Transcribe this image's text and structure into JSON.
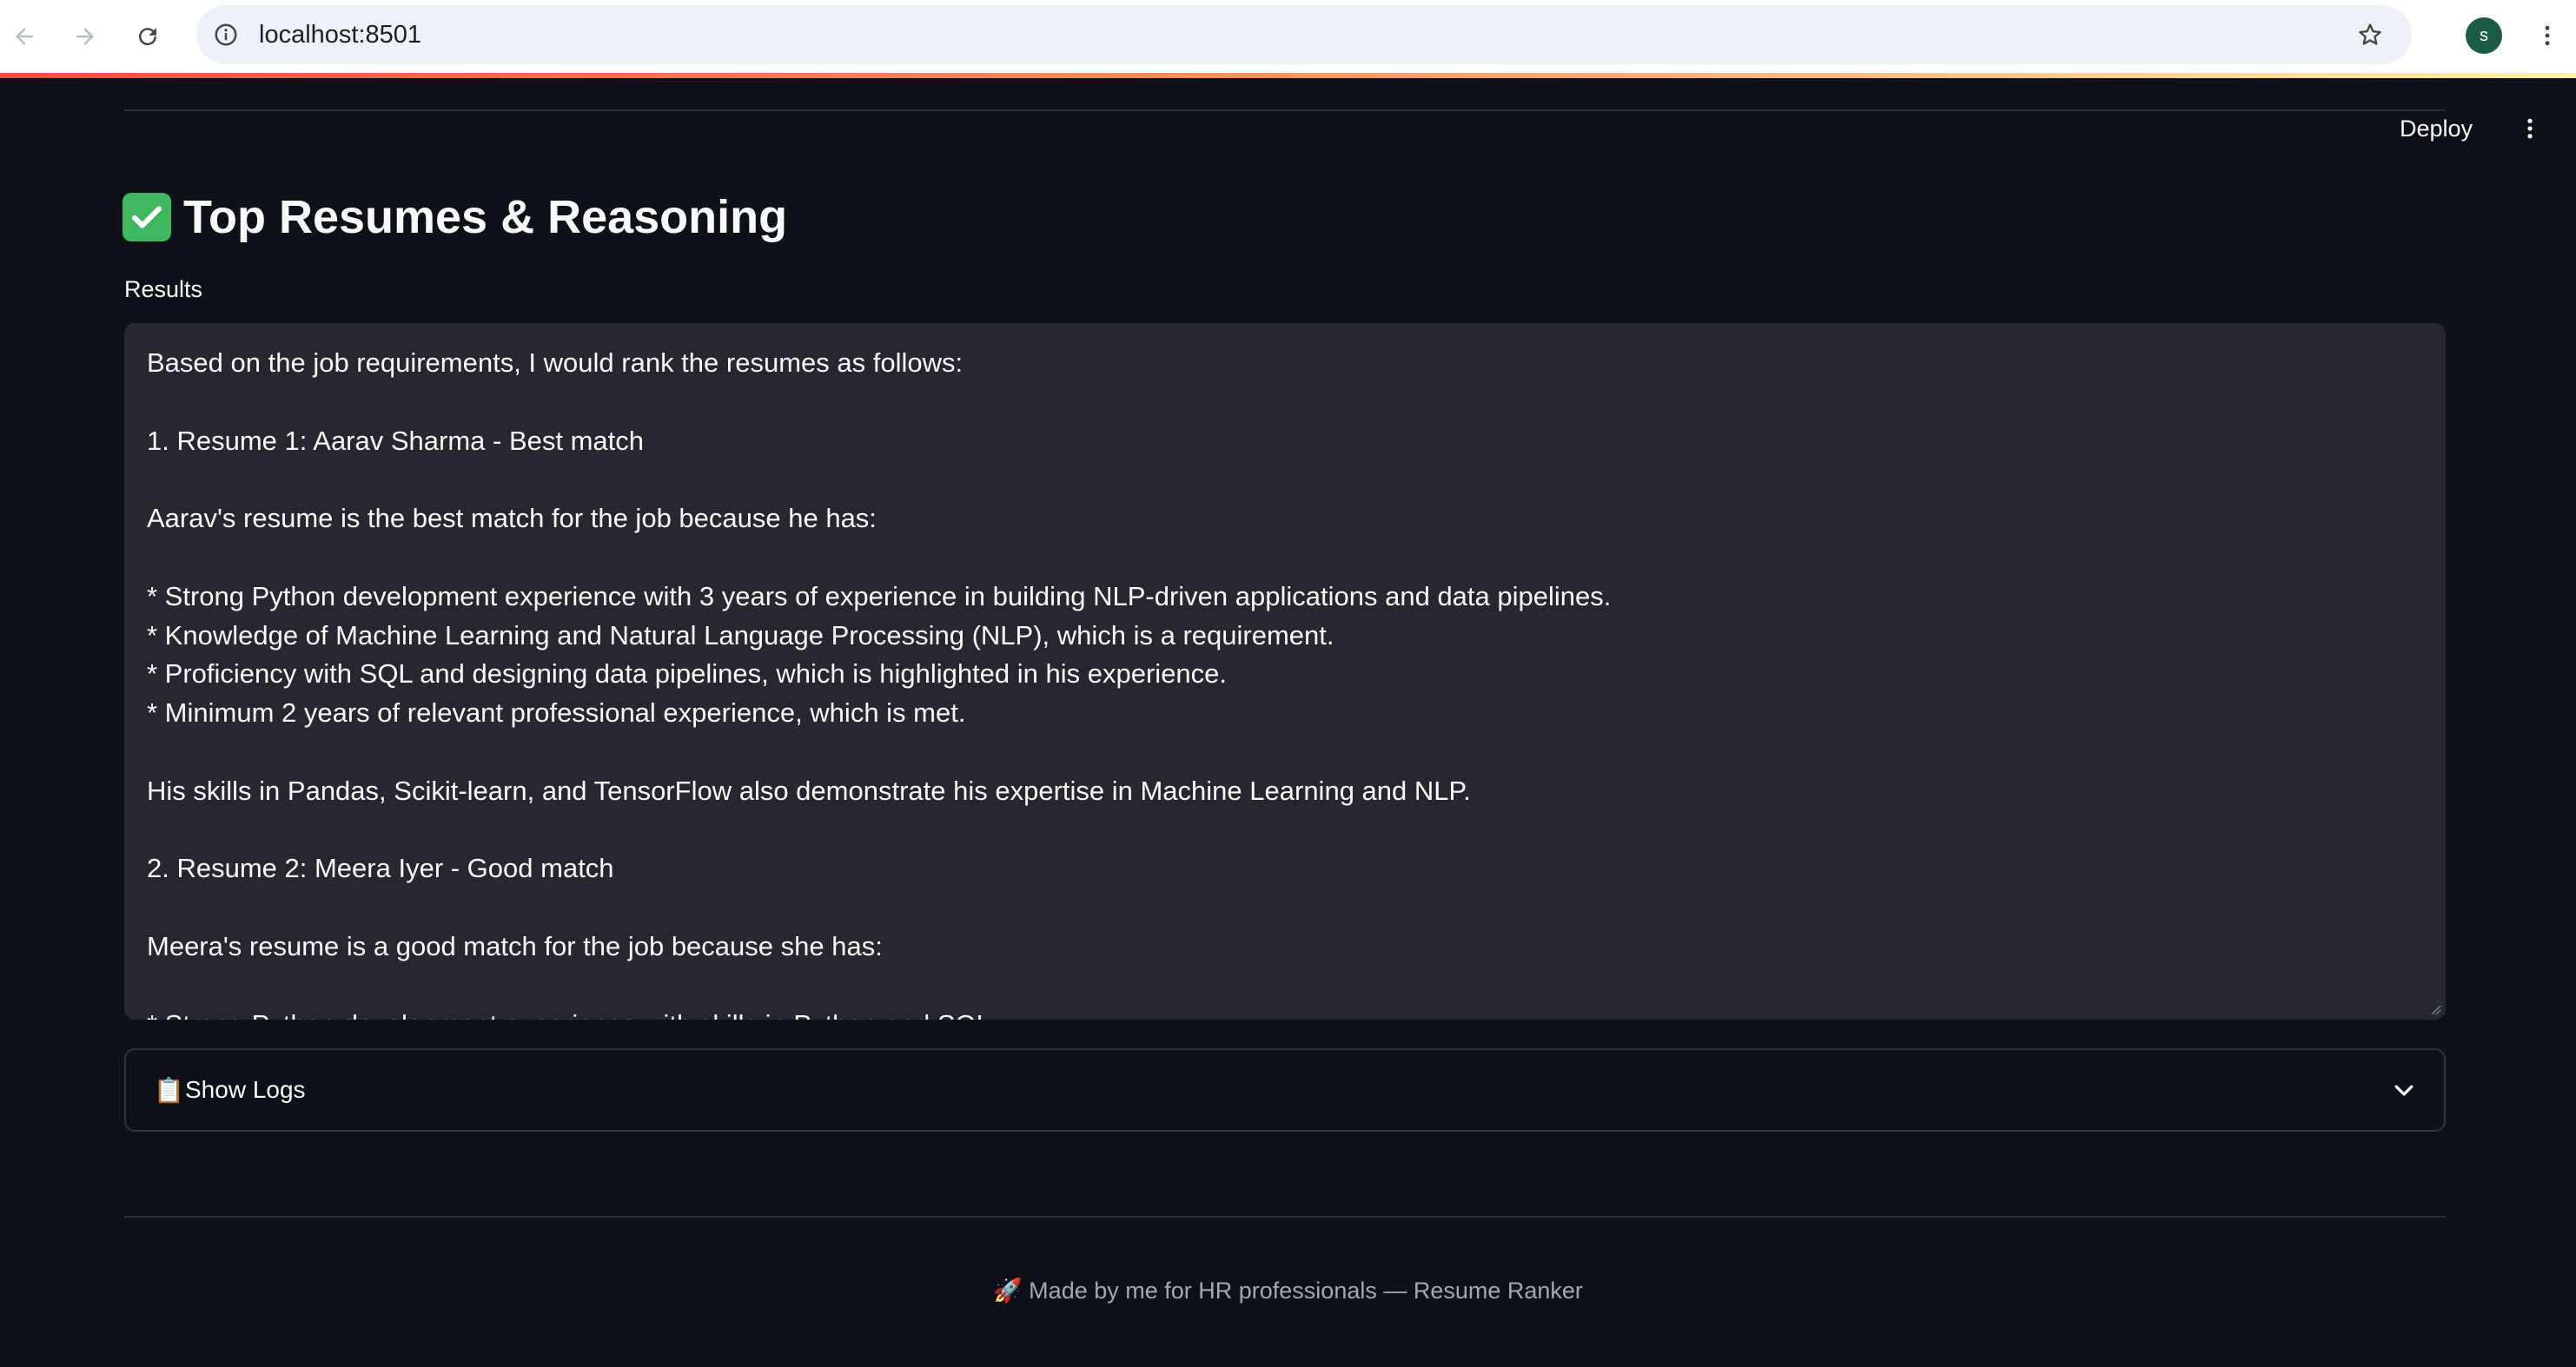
{
  "browser": {
    "url": "localhost:8501",
    "profile_initial": "s",
    "icons": [
      "back-arrow-icon",
      "forward-arrow-icon",
      "reload-icon",
      "site-info-icon",
      "bookmark-star-icon",
      "kebab-menu-icon"
    ]
  },
  "app": {
    "deploy_label": "Deploy",
    "title": "Top Resumes & Reasoning",
    "title_emoji": "✅",
    "results_label": "Results",
    "results_text": "Based on the job requirements, I would rank the resumes as follows:\n\n1. Resume 1: Aarav Sharma - Best match\n\nAarav's resume is the best match for the job because he has:\n\n* Strong Python development experience with 3 years of experience in building NLP-driven applications and data pipelines.\n* Knowledge of Machine Learning and Natural Language Processing (NLP), which is a requirement.\n* Proficiency with SQL and designing data pipelines, which is highlighted in his experience.\n* Minimum 2 years of relevant professional experience, which is met.\n\nHis skills in Pandas, Scikit-learn, and TensorFlow also demonstrate his expertise in Machine Learning and NLP.\n\n2. Resume 2: Meera Iyer - Good match\n\nMeera's resume is a good match for the job because she has:\n\n* Strong Python development experience with skills in Python and SQL.",
    "expander_icon": "📋",
    "expander_label": "Show Logs",
    "footer": "🚀 Made by me for HR professionals — Resume Ranker"
  },
  "colors": {
    "background": "#0e1117",
    "panel": "#262730",
    "text": "#fafafa",
    "muted": "#a3a8b4",
    "success": "#3fb75e"
  }
}
